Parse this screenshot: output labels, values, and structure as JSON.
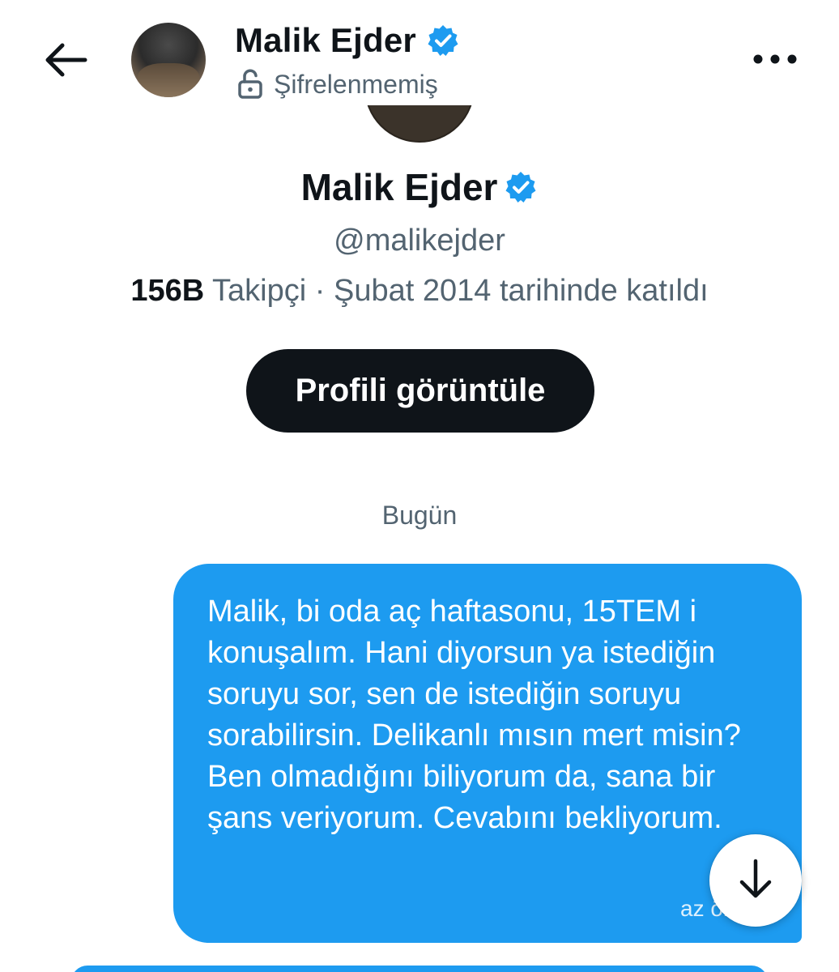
{
  "header": {
    "name": "Malik Ejder",
    "encryption_status": "Şifrelenmemiş",
    "icons": {
      "back": "back-arrow-icon",
      "verified": "verified-badge-icon",
      "lock": "unlocked-lock-icon",
      "more": "more-options-icon"
    }
  },
  "profile": {
    "name": "Malik Ejder",
    "handle": "@malikejder",
    "followers_count": "156B",
    "followers_label": "Takipçi",
    "separator": "·",
    "joined": "Şubat 2014 tarihinde katıldı",
    "view_profile_label": "Profili görüntüle"
  },
  "conversation": {
    "date_separator": "Bugün",
    "messages": [
      {
        "text": "Malik, bi oda aç haftasonu, 15TEM i konuşalım. Hani diyorsun ya istediğin soruyu sor, sen de istediğin soruyu sorabilirsin. Delikanlı mısın mert misin? Ben olmadığını biliyorum da, sana bir şans veriyorum. Cevabını bekliyorum.",
        "time": "az önce"
      }
    ],
    "scroll_down_icon": "arrow-down-icon"
  },
  "colors": {
    "accent": "#1d9bf0",
    "text_primary": "#0f1419",
    "text_secondary": "#536471",
    "button_dark": "#0f1419"
  }
}
